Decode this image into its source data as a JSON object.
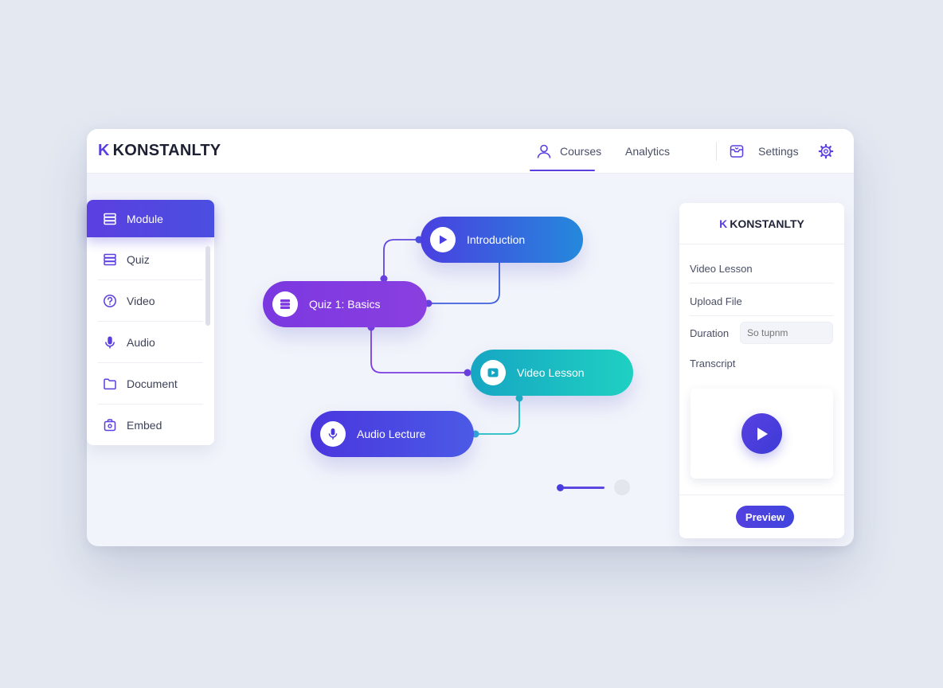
{
  "brand": {
    "letter": "K",
    "name": "KONSTANLTY"
  },
  "nav": {
    "courses": "Courses",
    "analytics": "Analytics",
    "settings": "Settings"
  },
  "sidebar": {
    "items": [
      {
        "label": "Module",
        "icon": "stack-icon",
        "active": true
      },
      {
        "label": "Quiz",
        "icon": "stack-icon"
      },
      {
        "label": "Video",
        "icon": "question-icon"
      },
      {
        "label": "Audio",
        "icon": "microphone-icon"
      },
      {
        "label": "Document",
        "icon": "folder-icon"
      },
      {
        "label": "Embed",
        "icon": "embed-icon"
      }
    ]
  },
  "flow": {
    "nodes": [
      {
        "label": "Introduction",
        "icon": "play-icon"
      },
      {
        "label": "Quiz 1: Basics",
        "icon": "stack-icon"
      },
      {
        "label": "Video Lesson",
        "icon": "video-icon"
      },
      {
        "label": "Audio Lecture",
        "icon": "microphone-icon"
      }
    ]
  },
  "panel": {
    "brand_letter": "K",
    "brand_name": "KONSTANLTY",
    "fields": {
      "video_lesson": "Video Lesson",
      "upload_file": "Upload File",
      "duration": "Duration",
      "duration_placeholder": "So tupnm",
      "transcript": "Transcript"
    },
    "preview_button": "Preview"
  },
  "colors": {
    "accent": "#5b3ee0",
    "intro_node": "#2489dc",
    "quiz_node": "#8a3fe0",
    "video_node": "#1fd0c2",
    "audio_node": "#4a36de",
    "background": "#e3e8f1"
  }
}
